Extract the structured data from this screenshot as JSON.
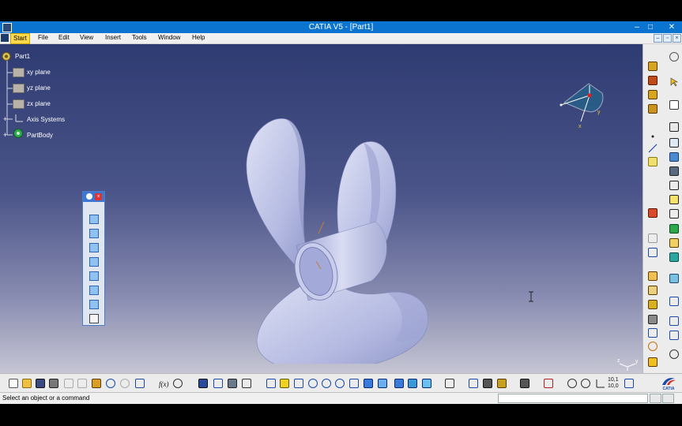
{
  "window": {
    "title": "CATIA V5 - [Part1]",
    "controls": {
      "minimize": "–",
      "maximize": "□",
      "close": "✕"
    }
  },
  "menu": {
    "items": [
      "Start",
      "File",
      "Edit",
      "View",
      "Insert",
      "Tools",
      "Window",
      "Help"
    ]
  },
  "tree": {
    "root": "Part1",
    "items": [
      "xy plane",
      "yz plane",
      "zx plane",
      "Axis Systems",
      "PartBody"
    ]
  },
  "compass_labels": {
    "x": "x",
    "y": "y",
    "z": "z"
  },
  "axis_triad": {
    "z": "z",
    "y": "y"
  },
  "float_toolbar": {
    "icons": [
      "isometric-view-icon",
      "front-view-icon",
      "back-view-icon",
      "left-view-icon",
      "right-view-icon",
      "top-view-icon",
      "bottom-view-icon",
      "named-views-icon"
    ]
  },
  "right_toolbar": {
    "zoom_ratio_top": "10,1",
    "zoom_ratio_bottom": "10,0"
  },
  "brand": "CATIA",
  "status": {
    "message": "Select an object or a command",
    "command_input": ""
  },
  "colors": {
    "title_bar": "#0b74d1",
    "viewport_top": "#2e3b72",
    "viewport_bottom": "#c5c5d3",
    "part_surface": "#b7bde6",
    "start_menu": "#ffd94a"
  }
}
